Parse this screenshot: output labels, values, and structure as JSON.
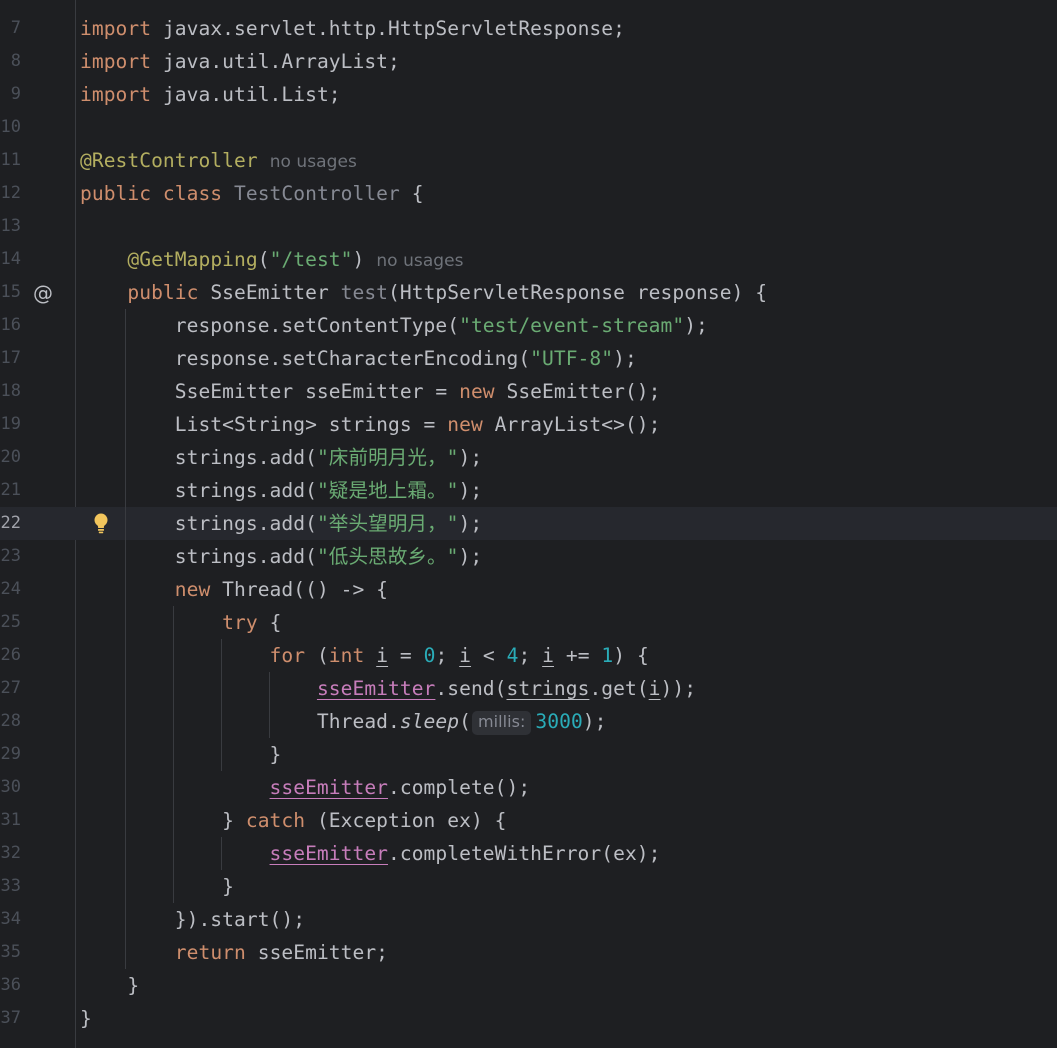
{
  "editor": {
    "lines": [
      {
        "num": "7",
        "parts": [
          {
            "t": "import",
            "c": "kw"
          },
          {
            "t": " javax.servlet.http.HttpServletResponse;"
          }
        ]
      },
      {
        "num": "8",
        "parts": [
          {
            "t": "import",
            "c": "kw"
          },
          {
            "t": " java.util.ArrayList;"
          }
        ]
      },
      {
        "num": "9",
        "parts": [
          {
            "t": "import",
            "c": "kw"
          },
          {
            "t": " java.util.List;"
          }
        ]
      },
      {
        "num": "10",
        "parts": []
      },
      {
        "num": "11",
        "parts": [
          {
            "t": "@RestController",
            "c": "ann"
          },
          {
            "t": "no usages",
            "c": "inlay"
          }
        ]
      },
      {
        "num": "12",
        "parts": [
          {
            "t": "public class ",
            "c": "kw"
          },
          {
            "t": "TestController",
            "c": "dim"
          },
          {
            "t": " {"
          }
        ]
      },
      {
        "num": "13",
        "parts": []
      },
      {
        "num": "14",
        "parts": [
          {
            "t": "    "
          },
          {
            "t": "@GetMapping",
            "c": "ann"
          },
          {
            "t": "("
          },
          {
            "t": "\"/test\"",
            "c": "str"
          },
          {
            "t": ")"
          },
          {
            "t": "no usages",
            "c": "inlay"
          }
        ]
      },
      {
        "num": "15",
        "parts": [
          {
            "t": "    "
          },
          {
            "t": "public ",
            "c": "kw"
          },
          {
            "t": "SseEmitter "
          },
          {
            "t": "test",
            "c": "dim"
          },
          {
            "t": "(HttpServletResponse response) {"
          }
        ]
      },
      {
        "num": "16",
        "parts": [
          {
            "t": "        response.setContentType("
          },
          {
            "t": "\"test/event-stream\"",
            "c": "str"
          },
          {
            "t": ");"
          }
        ]
      },
      {
        "num": "17",
        "parts": [
          {
            "t": "        response.setCharacterEncoding("
          },
          {
            "t": "\"UTF-8\"",
            "c": "str"
          },
          {
            "t": ");"
          }
        ]
      },
      {
        "num": "18",
        "parts": [
          {
            "t": "        SseEmitter sseEmitter = "
          },
          {
            "t": "new",
            "c": "kw"
          },
          {
            "t": " SseEmitter();"
          }
        ]
      },
      {
        "num": "19",
        "parts": [
          {
            "t": "        List<String> strings = "
          },
          {
            "t": "new",
            "c": "kw"
          },
          {
            "t": " ArrayList<>();"
          }
        ]
      },
      {
        "num": "20",
        "parts": [
          {
            "t": "        strings.add("
          },
          {
            "t": "\"",
            "c": "str"
          },
          {
            "t": "床前明月光，",
            "c": "str cjk"
          },
          {
            "t": "\"",
            "c": "str"
          },
          {
            "t": ");"
          }
        ]
      },
      {
        "num": "21",
        "parts": [
          {
            "t": "        strings.add("
          },
          {
            "t": "\"",
            "c": "str"
          },
          {
            "t": "疑是地上霜。",
            "c": "str cjk"
          },
          {
            "t": "\"",
            "c": "str"
          },
          {
            "t": ");"
          }
        ]
      },
      {
        "num": "22",
        "current": true,
        "parts": [
          {
            "t": "        strings.add("
          },
          {
            "t": "\"",
            "c": "str"
          },
          {
            "t": "举头望明月，",
            "c": "str cjk"
          },
          {
            "t": "\"",
            "c": "str"
          },
          {
            "t": ");"
          }
        ]
      },
      {
        "num": "23",
        "parts": [
          {
            "t": "        strings.add("
          },
          {
            "t": "\"",
            "c": "str"
          },
          {
            "t": "低头思故乡。",
            "c": "str cjk"
          },
          {
            "t": "\"",
            "c": "str"
          },
          {
            "t": ");"
          }
        ]
      },
      {
        "num": "24",
        "parts": [
          {
            "t": "        "
          },
          {
            "t": "new",
            "c": "kw"
          },
          {
            "t": " Thread(() -> {"
          }
        ]
      },
      {
        "num": "25",
        "parts": [
          {
            "t": "            "
          },
          {
            "t": "try",
            "c": "kw"
          },
          {
            "t": " {"
          }
        ]
      },
      {
        "num": "26",
        "parts": [
          {
            "t": "                "
          },
          {
            "t": "for",
            "c": "kw"
          },
          {
            "t": " ("
          },
          {
            "t": "int",
            "c": "kw"
          },
          {
            "t": " "
          },
          {
            "t": "i",
            "c": "ul"
          },
          {
            "t": " = "
          },
          {
            "t": "0",
            "c": "num"
          },
          {
            "t": "; "
          },
          {
            "t": "i",
            "c": "ul"
          },
          {
            "t": " < "
          },
          {
            "t": "4",
            "c": "num"
          },
          {
            "t": "; "
          },
          {
            "t": "i",
            "c": "ul"
          },
          {
            "t": " += "
          },
          {
            "t": "1",
            "c": "num"
          },
          {
            "t": ") {"
          }
        ]
      },
      {
        "num": "27",
        "parts": [
          {
            "t": "                    "
          },
          {
            "t": "sseEmitter",
            "c": "fld"
          },
          {
            "t": ".send("
          },
          {
            "t": "strings",
            "c": "ul"
          },
          {
            "t": ".get("
          },
          {
            "t": "i",
            "c": "ul"
          },
          {
            "t": "));"
          }
        ]
      },
      {
        "num": "28",
        "parts": [
          {
            "t": "                    Thread."
          },
          {
            "t": "sleep",
            "c": "it"
          },
          {
            "t": "("
          },
          {
            "t": "millis:",
            "c": "hint"
          },
          {
            "t": "3000",
            "c": "num"
          },
          {
            "t": ");"
          }
        ]
      },
      {
        "num": "29",
        "parts": [
          {
            "t": "                }"
          }
        ]
      },
      {
        "num": "30",
        "parts": [
          {
            "t": "                "
          },
          {
            "t": "sseEmitter",
            "c": "fld"
          },
          {
            "t": ".complete();"
          }
        ]
      },
      {
        "num": "31",
        "parts": [
          {
            "t": "            } "
          },
          {
            "t": "catch",
            "c": "kw"
          },
          {
            "t": " (Exception ex) {"
          }
        ]
      },
      {
        "num": "32",
        "parts": [
          {
            "t": "                "
          },
          {
            "t": "sseEmitter",
            "c": "fld"
          },
          {
            "t": ".completeWithError(ex);"
          }
        ]
      },
      {
        "num": "33",
        "parts": [
          {
            "t": "            }"
          }
        ]
      },
      {
        "num": "34",
        "parts": [
          {
            "t": "        }).start();"
          }
        ]
      },
      {
        "num": "35",
        "parts": [
          {
            "t": "        "
          },
          {
            "t": "return",
            "c": "kw"
          },
          {
            "t": " sseEmitter;"
          }
        ]
      },
      {
        "num": "36",
        "parts": [
          {
            "t": "    }"
          }
        ]
      },
      {
        "num": "37",
        "parts": [
          {
            "t": "}"
          }
        ]
      }
    ],
    "gutter_icons": [
      {
        "line": "15",
        "icon": "implemented-at-icon",
        "glyph": "@"
      },
      {
        "line": "22",
        "icon": "lightbulb-icon",
        "glyph": ""
      }
    ],
    "colors": {
      "background": "#1e1f22",
      "keyword": "#cf8e6d",
      "string": "#6aab73",
      "number": "#2aacb8",
      "annotation": "#b3ae60",
      "field": "#c77dbb",
      "text": "#bcbec4",
      "current_line": "#26282e"
    }
  }
}
